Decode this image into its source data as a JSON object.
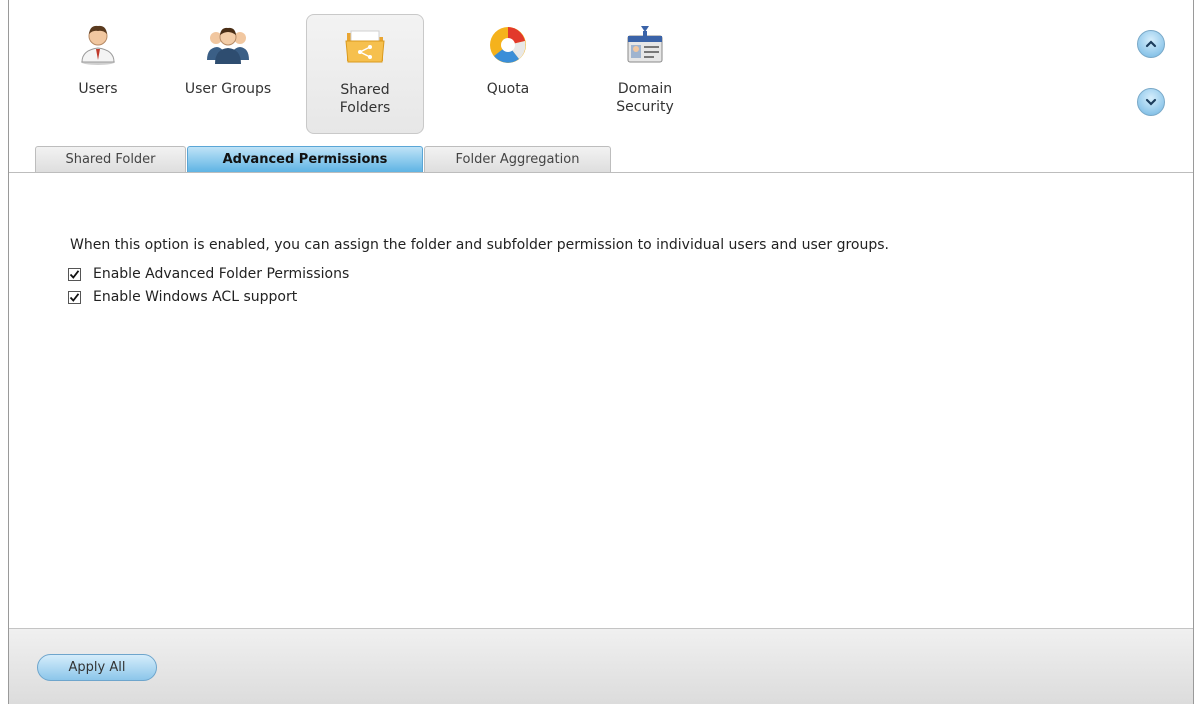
{
  "toolbar": {
    "items": [
      {
        "label": "Users",
        "icon": "user-icon"
      },
      {
        "label": "User Groups",
        "icon": "user-groups-icon"
      },
      {
        "label": "Shared\nFolders",
        "icon": "shared-folder-icon",
        "active": true
      },
      {
        "label": "Quota",
        "icon": "quota-pie-icon"
      },
      {
        "label": "Domain\nSecurity",
        "icon": "domain-security-icon"
      }
    ],
    "scroll_up_icon": "chevron-up-icon",
    "scroll_down_icon": "chevron-down-icon"
  },
  "tabs": [
    {
      "label": "Shared Folder",
      "active": false
    },
    {
      "label": "Advanced Permissions",
      "active": true
    },
    {
      "label": "Folder Aggregation",
      "active": false
    }
  ],
  "content": {
    "description": "When this option is enabled, you can assign the folder and subfolder permission to individual users and user groups.",
    "options": [
      {
        "label": "Enable Advanced Folder Permissions",
        "checked": true
      },
      {
        "label": "Enable Windows ACL support",
        "checked": true
      }
    ]
  },
  "footer": {
    "apply_label": "Apply All"
  },
  "colors": {
    "accent": "#5fb4e4",
    "button": "#8cc6ea"
  }
}
